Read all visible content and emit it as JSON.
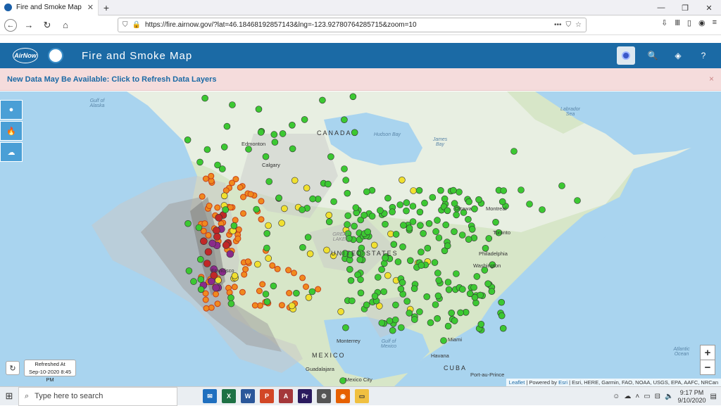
{
  "browser": {
    "tab_title": "Fire and Smoke Map",
    "url": "https://fire.airnow.gov/?lat=46.18468192857143&lng=-123.92780764285715&zoom=10"
  },
  "app": {
    "logo_text": "AirNow",
    "title": "Fire and Smoke Map"
  },
  "banner": {
    "text": "New Data May Be Available: Click to Refresh Data Layers",
    "close": "×"
  },
  "map": {
    "labels": {
      "canada": "CANADA",
      "united_states": "UNITED STATES",
      "mexico": "MEXICO",
      "cuba": "CUBA",
      "gulf_alaska": "Gulf of Alaska",
      "hudson_bay": "Hudson Bay",
      "labrador_sea": "Labrador Sea",
      "james_bay": "James Bay",
      "gulf_mexico": "Gulf of Mexico",
      "atlantic": "Atlantic Ocean",
      "great_lakes": "GREAT LAKES",
      "edmonton": "Edmonton",
      "calgary": "Calgary",
      "ottawa": "Ottawa",
      "montreal": "Montreal",
      "toronto": "Toronto",
      "philadelphia": "Philadelphia",
      "washington": "Washington",
      "miami": "Miami",
      "havana": "Havana",
      "monterrey": "Monterrey",
      "mexico_city": "Mexico City",
      "guadalajara": "Guadalajara",
      "francisco": "Francisco",
      "port_au_prince": "Port-au-Prince"
    },
    "refreshed_label": "Refreshed At",
    "refreshed_time": "Sep-10-2020 8:45 PM",
    "zoom_in": "+",
    "zoom_out": "−",
    "attribution_leaflet": "Leaflet",
    "attribution_powered": " | Powered by ",
    "attribution_esri": "Esri",
    "attribution_rest": " | Esri, HERE, Garmin, FAO, NOAA, USGS, EPA, AAFC, NRCan",
    "colors": {
      "good": "#3cc832",
      "moderate": "#f0e030",
      "usg": "#f08a1e",
      "unhealthy": "#c02828",
      "very_unhealthy": "#8a2a8a",
      "smoke_light": "#c8c8c8",
      "smoke_medium": "#a0a0a0",
      "smoke_heavy": "#787878"
    }
  },
  "taskbar": {
    "search_placeholder": "Type here to search",
    "time": "9:17 PM",
    "date": "9/10/2020"
  }
}
